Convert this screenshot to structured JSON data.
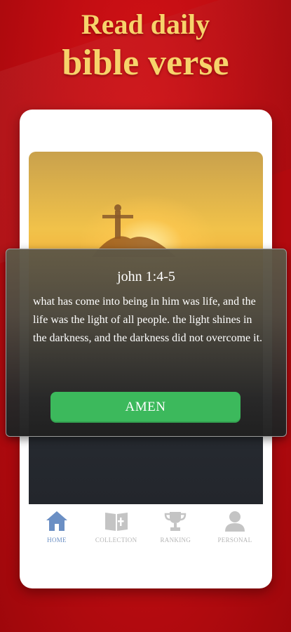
{
  "headline": {
    "line1": "Read daily",
    "line2": "bible verse"
  },
  "dialog": {
    "reference": "john 1:4-5",
    "verse": "what has come into being in him was life, and the life was the light of all people. the light shines in the darkness, and the darkness did not overcome it.",
    "button_label": "AMEN"
  },
  "tabs": [
    {
      "label": "HOME",
      "icon": "home-icon",
      "active": true
    },
    {
      "label": "COLLECTION",
      "icon": "book-icon",
      "active": false
    },
    {
      "label": "RANKING",
      "icon": "trophy-icon",
      "active": false
    },
    {
      "label": "PERSONAL",
      "icon": "person-icon",
      "active": false
    }
  ],
  "colors": {
    "background": "#c20d12",
    "headline": "#f7d36b",
    "amen_button": "#3cb95c",
    "tab_active": "#6b8fc4",
    "tab_inactive": "#b5b5b5"
  }
}
